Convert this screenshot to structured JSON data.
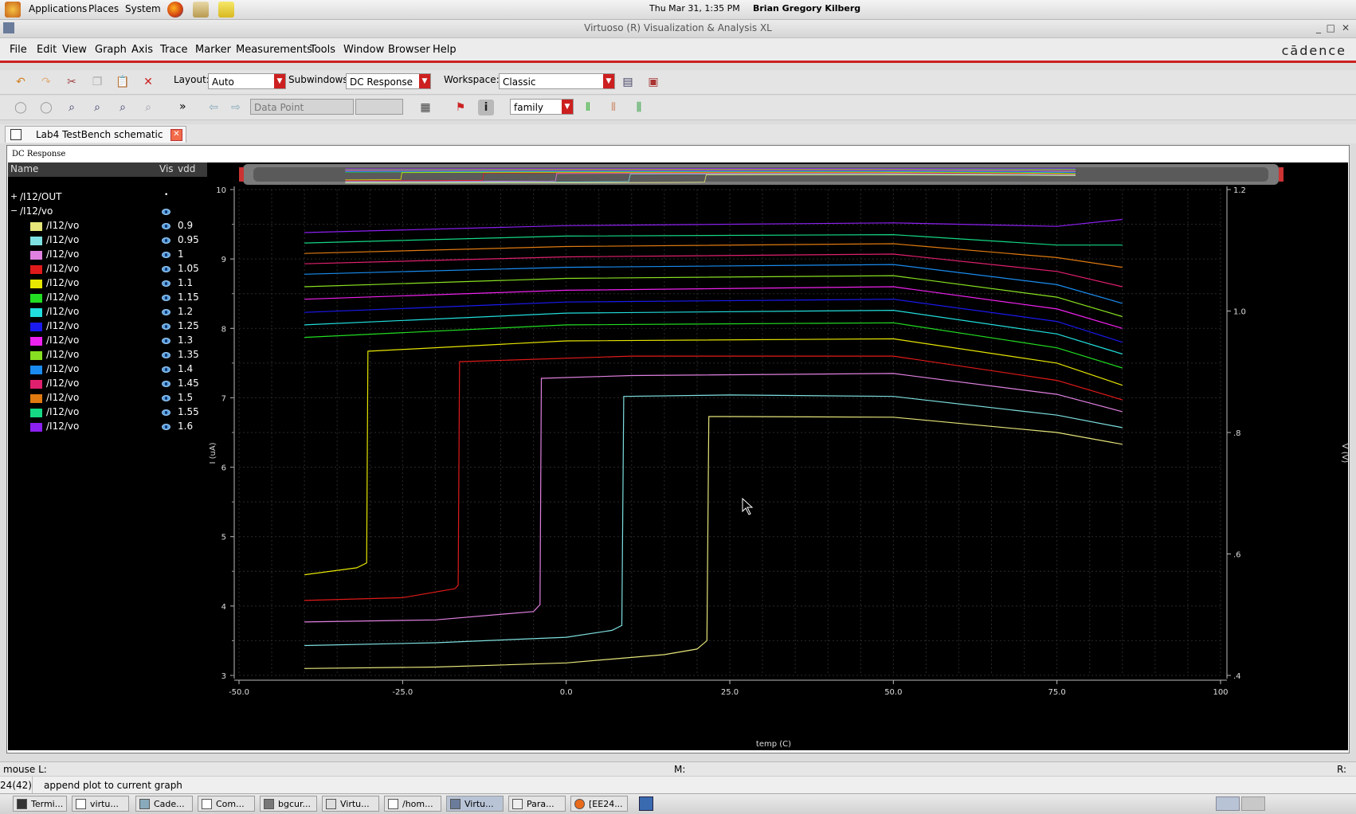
{
  "top_panel": {
    "menus": [
      "Applications",
      "Places",
      "System"
    ],
    "clock": "Thu Mar 31,  1:35 PM",
    "user": "Brian Gregory Kilberg"
  },
  "window": {
    "title": "Virtuoso (R) Visualization & Analysis XL",
    "controls": [
      "_",
      "□",
      "✕"
    ]
  },
  "menu": {
    "items": [
      "File",
      "Edit",
      "View",
      "Graph",
      "Axis",
      "Trace",
      "Marker",
      "Measurements",
      "Tools",
      "Window",
      "Browser",
      "Help"
    ],
    "logo": "cādence"
  },
  "toolbar1": {
    "layout_label": "Layout:",
    "layout_value": "Auto",
    "subwindows_label": "Subwindows:",
    "subwindows_value": "DC Response",
    "workspace_label": "Workspace:",
    "workspace_value": "Classic"
  },
  "toolbar2": {
    "marker_value": "Data Point",
    "more": "»",
    "family_value": "family"
  },
  "tab": {
    "label": "Lab4 TestBench schematic"
  },
  "subwindow": {
    "title": "DC Response"
  },
  "legend": {
    "col_name": "Name",
    "col_vis": "Vis",
    "col_vdd": "vdd",
    "groups": [
      {
        "expander": "+",
        "name": "/I12/OUT",
        "vis": "•"
      },
      {
        "expander": "−",
        "name": "/I12/vo",
        "vis": "eye"
      }
    ],
    "rows": [
      {
        "name": "/I12/vo",
        "vdd": "0.9",
        "color": "#e6e67a"
      },
      {
        "name": "/I12/vo",
        "vdd": "0.95",
        "color": "#7ee0e0"
      },
      {
        "name": "/I12/vo",
        "vdd": "1",
        "color": "#e080e0"
      },
      {
        "name": "/I12/vo",
        "vdd": "1.05",
        "color": "#e01a1a"
      },
      {
        "name": "/I12/vo",
        "vdd": "1.1",
        "color": "#e6e600"
      },
      {
        "name": "/I12/vo",
        "vdd": "1.15",
        "color": "#22dd22"
      },
      {
        "name": "/I12/vo",
        "vdd": "1.2",
        "color": "#22dddd"
      },
      {
        "name": "/I12/vo",
        "vdd": "1.25",
        "color": "#1a1aee"
      },
      {
        "name": "/I12/vo",
        "vdd": "1.3",
        "color": "#ee22ee"
      },
      {
        "name": "/I12/vo",
        "vdd": "1.35",
        "color": "#88e022"
      },
      {
        "name": "/I12/vo",
        "vdd": "1.4",
        "color": "#1a8cf0"
      },
      {
        "name": "/I12/vo",
        "vdd": "1.45",
        "color": "#e0206e"
      },
      {
        "name": "/I12/vo",
        "vdd": "1.5",
        "color": "#e07a10"
      },
      {
        "name": "/I12/vo",
        "vdd": "1.55",
        "color": "#14d884"
      },
      {
        "name": "/I12/vo",
        "vdd": "1.6",
        "color": "#8c20f0"
      }
    ]
  },
  "chart_data": {
    "type": "line",
    "xlabel": "temp (C)",
    "ylabel": "I (uA)",
    "y2label": "V (V)",
    "xlim": [
      -50,
      100
    ],
    "ylim": [
      3,
      10
    ],
    "y2lim": [
      0.4,
      1.2
    ],
    "xticks": [
      "-50.0",
      "-25.0",
      "0.0",
      "25.0",
      "50.0",
      "75.0",
      "100"
    ],
    "yticks": [
      "3",
      "4",
      "5",
      "6",
      "7",
      "8",
      "9",
      "10"
    ],
    "y2ticks": [
      ".4",
      ".6",
      ".8",
      "1.0",
      "1.2"
    ],
    "grid": true,
    "series": [
      {
        "name": "0.9",
        "color": "#e6e67a",
        "x": [
          -40,
          -20,
          0,
          15,
          20,
          21.5,
          21.8,
          25,
          50,
          75,
          85
        ],
        "y": [
          3.1,
          3.12,
          3.18,
          3.3,
          3.38,
          3.5,
          6.73,
          6.73,
          6.72,
          6.5,
          6.33
        ]
      },
      {
        "name": "0.95",
        "color": "#7ee0e0",
        "x": [
          -40,
          -20,
          0,
          7,
          8.5,
          8.8,
          25,
          50,
          75,
          85
        ],
        "y": [
          3.43,
          3.47,
          3.55,
          3.65,
          3.72,
          7.02,
          7.04,
          7.02,
          6.75,
          6.57
        ]
      },
      {
        "name": "1",
        "color": "#e080e0",
        "x": [
          -40,
          -20,
          -5,
          -4,
          -3.8,
          10,
          50,
          75,
          85
        ],
        "y": [
          3.77,
          3.8,
          3.92,
          4.02,
          7.28,
          7.32,
          7.35,
          7.05,
          6.8
        ]
      },
      {
        "name": "1.05",
        "color": "#e01a1a",
        "x": [
          -40,
          -25,
          -17,
          -16.5,
          -16.3,
          10,
          50,
          75,
          85
        ],
        "y": [
          4.08,
          4.12,
          4.25,
          4.3,
          7.52,
          7.6,
          7.6,
          7.25,
          6.97
        ]
      },
      {
        "name": "1.1",
        "color": "#e6e600",
        "x": [
          -40,
          -32,
          -30.5,
          -30.3,
          0,
          50,
          75,
          85
        ],
        "y": [
          4.45,
          4.55,
          4.62,
          7.67,
          7.82,
          7.85,
          7.5,
          7.18
        ]
      },
      {
        "name": "1.15",
        "color": "#22dd22",
        "x": [
          -40,
          0,
          50,
          75,
          85
        ],
        "y": [
          7.87,
          8.05,
          8.08,
          7.72,
          7.43
        ]
      },
      {
        "name": "1.2",
        "color": "#22dddd",
        "x": [
          -40,
          0,
          50,
          75,
          85
        ],
        "y": [
          8.05,
          8.22,
          8.26,
          7.92,
          7.63
        ]
      },
      {
        "name": "1.25",
        "color": "#1a1aee",
        "x": [
          -40,
          0,
          50,
          75,
          85
        ],
        "y": [
          8.23,
          8.38,
          8.42,
          8.1,
          7.8
        ]
      },
      {
        "name": "1.3",
        "color": "#ee22ee",
        "x": [
          -40,
          0,
          50,
          75,
          85
        ],
        "y": [
          8.42,
          8.55,
          8.6,
          8.28,
          8.0
        ]
      },
      {
        "name": "1.35",
        "color": "#88e022",
        "x": [
          -40,
          0,
          50,
          75,
          85
        ],
        "y": [
          8.6,
          8.72,
          8.76,
          8.45,
          8.17
        ]
      },
      {
        "name": "1.4",
        "color": "#1a8cf0",
        "x": [
          -40,
          0,
          50,
          75,
          85
        ],
        "y": [
          8.78,
          8.88,
          8.92,
          8.63,
          8.36
        ]
      },
      {
        "name": "1.45",
        "color": "#e0206e",
        "x": [
          -40,
          0,
          50,
          75,
          85
        ],
        "y": [
          8.93,
          9.03,
          9.07,
          8.82,
          8.6
        ]
      },
      {
        "name": "1.5",
        "color": "#e07a10",
        "x": [
          -40,
          0,
          50,
          75,
          85
        ],
        "y": [
          9.08,
          9.18,
          9.22,
          9.02,
          8.88
        ]
      },
      {
        "name": "1.55",
        "color": "#14d884",
        "x": [
          -40,
          0,
          50,
          75,
          85
        ],
        "y": [
          9.23,
          9.33,
          9.35,
          9.2,
          9.2
        ]
      },
      {
        "name": "1.6",
        "color": "#8c20f0",
        "x": [
          -40,
          0,
          50,
          75,
          85
        ],
        "y": [
          9.38,
          9.48,
          9.52,
          9.47,
          9.57
        ]
      }
    ]
  },
  "status": {
    "mouse_l": "mouse L:",
    "mouse_m": "M:",
    "mouse_r": "R:",
    "counter": "24(42)",
    "message": "append plot to current graph"
  },
  "taskbar": {
    "tasks": [
      "Termi...",
      "virtu...",
      "Cade...",
      "Com...",
      "bgcur...",
      "Virtu...",
      "/hom...",
      "Virtu...",
      "Para...",
      "[EE24..."
    ]
  }
}
